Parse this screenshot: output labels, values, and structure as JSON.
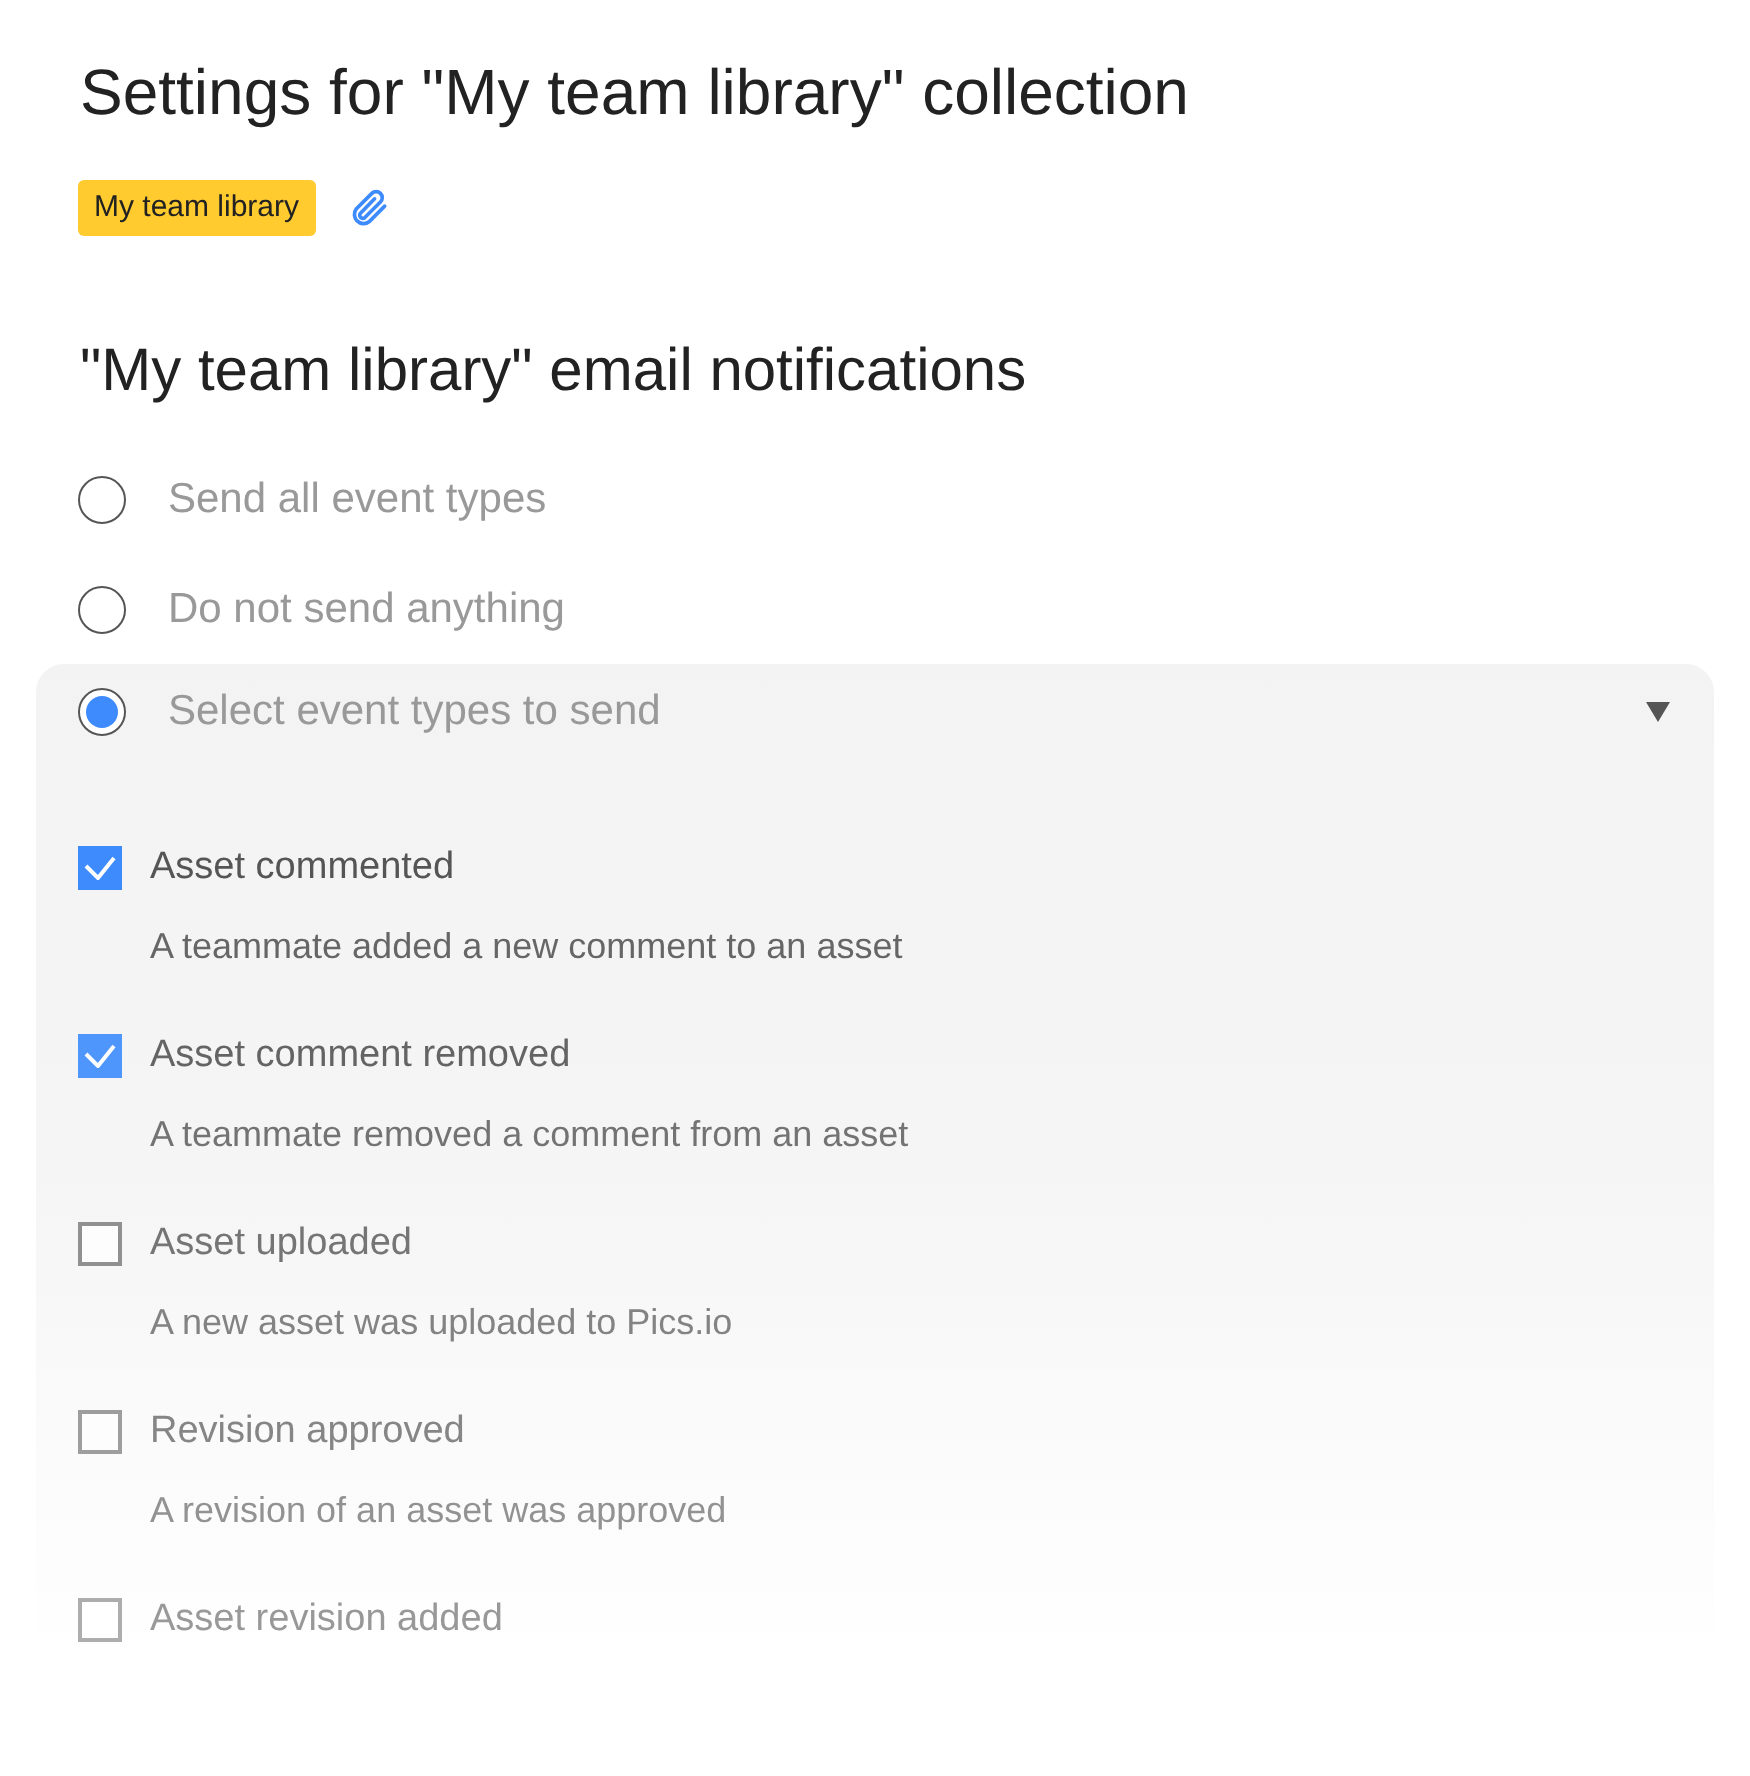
{
  "title": "Settings for \"My team library\" collection",
  "tag": {
    "label": "My team library"
  },
  "notifications": {
    "heading": "\"My team library\" email notifications",
    "options": [
      {
        "label": "Send all event types",
        "selected": false
      },
      {
        "label": "Do not send anything",
        "selected": false
      },
      {
        "label": "Select event types to send",
        "selected": true,
        "expanded": true
      }
    ],
    "events": [
      {
        "label": "Asset commented",
        "description": "A teammate added a new comment to an asset",
        "checked": true
      },
      {
        "label": "Asset comment removed",
        "description": "A teammate removed a comment from an asset",
        "checked": true
      },
      {
        "label": "Asset uploaded",
        "description": "A new asset was uploaded to Pics.io",
        "checked": false
      },
      {
        "label": "Revision approved",
        "description": "A revision of an asset was approved",
        "checked": false
      },
      {
        "label": "Asset revision added",
        "checked": false
      }
    ]
  }
}
